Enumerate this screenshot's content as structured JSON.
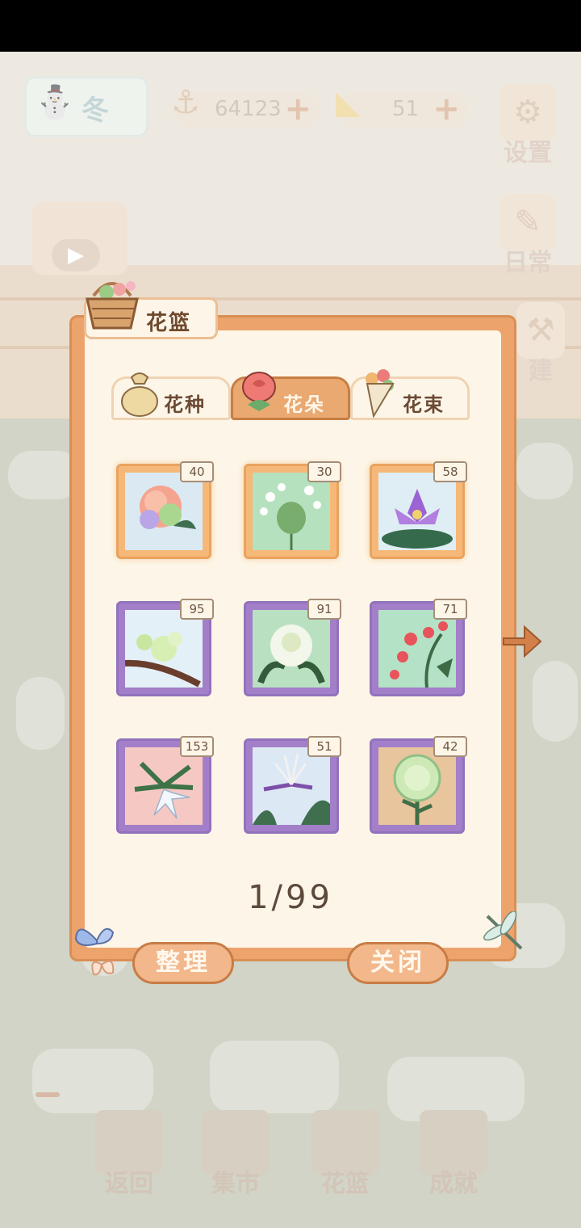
{
  "hud": {
    "season": "冬",
    "fish_coins": "64123",
    "cheese": "51",
    "settings_label": "设置",
    "daily_label": "日常",
    "build_label": "建"
  },
  "dialog": {
    "title": "花篮",
    "tabs": [
      "花种",
      "花朵",
      "花束"
    ],
    "active_tab": "花朵",
    "items": [
      {
        "count": "40",
        "frame": "orange",
        "bg": "#dbeaf2",
        "flower": "peony"
      },
      {
        "count": "30",
        "frame": "orange",
        "bg": "#b6e1be",
        "flower": "white-cluster"
      },
      {
        "count": "58",
        "frame": "orange",
        "bg": "#dfeef4",
        "flower": "water-lily"
      },
      {
        "count": "95",
        "frame": "purple",
        "bg": "#e3f0f7",
        "flower": "magnolia"
      },
      {
        "count": "91",
        "frame": "purple",
        "bg": "#b9e1c1",
        "flower": "white-peony"
      },
      {
        "count": "71",
        "frame": "purple",
        "bg": "#b4e2c6",
        "flower": "red-blossom"
      },
      {
        "count": "153",
        "frame": "purple",
        "bg": "#f6c8c4",
        "flower": "white-star"
      },
      {
        "count": "51",
        "frame": "purple",
        "bg": "#dde8f5",
        "flower": "bird-of-paradise"
      },
      {
        "count": "42",
        "frame": "purple",
        "bg": "#e8c59d",
        "flower": "chrysanthemum"
      }
    ],
    "page": "1/99",
    "arrange_label": "整理",
    "close_label": "关闭"
  },
  "bottom_nav": [
    "返回",
    "集市",
    "花篮",
    "成就"
  ]
}
